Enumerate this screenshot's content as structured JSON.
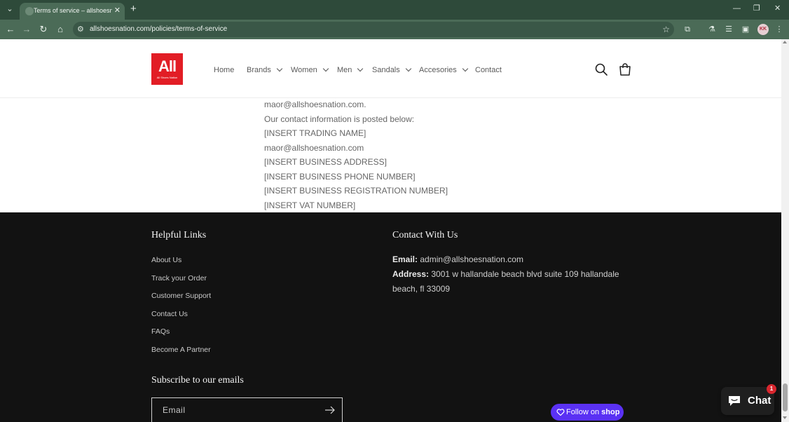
{
  "browser": {
    "tab_title": "Terms of service – allshoesnation",
    "url": "allshoesnation.com/policies/terms-of-service",
    "new_tab_label": "+",
    "profile_initials": "KK"
  },
  "header": {
    "logo_text": "All",
    "logo_subtext": "All Shoes Nation",
    "nav_items": [
      {
        "label": "Home",
        "dropdown": false
      },
      {
        "label": "Brands",
        "dropdown": true
      },
      {
        "label": "Women",
        "dropdown": true
      },
      {
        "label": "Men",
        "dropdown": true
      },
      {
        "label": "Sandals",
        "dropdown": true
      },
      {
        "label": "Accesories",
        "dropdown": true
      },
      {
        "label": "Contact",
        "dropdown": false
      }
    ]
  },
  "content": {
    "lines": [
      "maor@allshoesnation.com.",
      "Our contact information is posted below:",
      "[INSERT TRADING NAME]",
      "maor@allshoesnation.com",
      "[INSERT BUSINESS ADDRESS]",
      "[INSERT BUSINESS PHONE NUMBER]",
      "[INSERT BUSINESS REGISTRATION NUMBER]",
      "[INSERT VAT NUMBER]"
    ]
  },
  "footer": {
    "helpful_links_title": "Helpful Links",
    "links": [
      "About Us",
      "Track your Order",
      "Customer Support",
      "Contact Us",
      "FAQs",
      "Become A Partner"
    ],
    "contact_title": "Contact With Us",
    "email_label": "Email:",
    "email_value": "admin@allshoesnation.com",
    "address_label": "Address:",
    "address_value": "3001 w hallandale beach blvd suite 109 hallandale beach, fl 33009",
    "subscribe_title": "Subscribe to our emails",
    "email_placeholder": "Email"
  },
  "widgets": {
    "follow_label": "Follow on",
    "follow_brand": "shop",
    "chat_label": "Chat",
    "chat_badge": "1"
  },
  "colors": {
    "brand_red": "#e21d25",
    "footer_bg": "#121212",
    "shop_purple": "#5a31f4",
    "chrome_green": "#4b6b57"
  }
}
